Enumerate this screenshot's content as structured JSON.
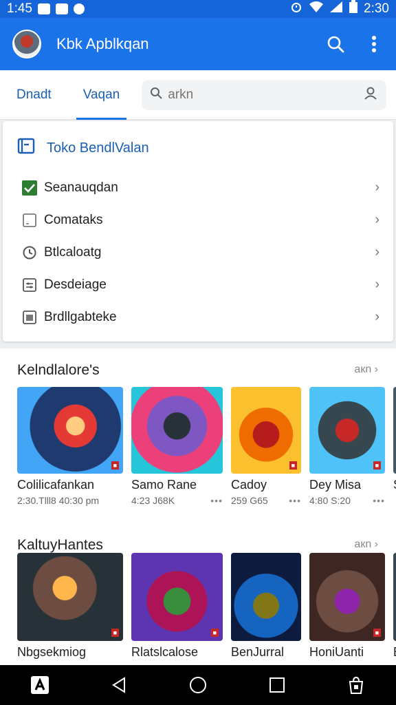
{
  "status_bar": {
    "time_left": "1:45",
    "time_right": "2:30",
    "icons": [
      "image-icon",
      "photo-icon",
      "shield-icon",
      "alarm-icon",
      "wifi-icon",
      "signal-icon",
      "battery-icon"
    ]
  },
  "app_bar": {
    "title": "Kbk Apblkqan",
    "actions": [
      "search-icon",
      "more-vert-icon"
    ]
  },
  "tabs": [
    {
      "label": "Dnadt",
      "selected": false
    },
    {
      "label": "Vaqan",
      "selected": true
    }
  ],
  "search": {
    "value": "",
    "placeholder": "arkn"
  },
  "category_card": {
    "title": "Toko BendlValan",
    "items": [
      {
        "label": "Seanauqdan",
        "icon": "checkbox-checked-icon"
      },
      {
        "label": "Comataks",
        "icon": "checkbox-empty-icon"
      },
      {
        "label": "Btlcaloatg",
        "icon": "history-icon"
      },
      {
        "label": "Desdeiage",
        "icon": "settings-box-icon"
      },
      {
        "label": "Brdllgabteke",
        "icon": "calendar-icon"
      }
    ]
  },
  "section_1": {
    "title": "Kelndlalore's",
    "more": "aкn",
    "games": [
      {
        "name": "Colilicafankan",
        "meta": "2:30.Tlll8  40:30 pm"
      },
      {
        "name": "Samo Rane",
        "meta": "4:23 J68K"
      },
      {
        "name": "Cadoy",
        "meta": "259 G65"
      },
      {
        "name": "Dey Misa",
        "meta": "4:80 S:20"
      },
      {
        "name": "S",
        "meta": ""
      }
    ]
  },
  "section_2": {
    "title": "KaltuyHantes",
    "more": "aкn",
    "games": [
      {
        "name": "Nbgsekmiog",
        "meta": ""
      },
      {
        "name": "Rlatslcalose",
        "meta": ""
      },
      {
        "name": "BenJurral",
        "meta": ""
      },
      {
        "name": "HoniUanti",
        "meta": ""
      },
      {
        "name": "E",
        "meta": ""
      }
    ]
  },
  "nav_bar": {
    "buttons": [
      "app-icon",
      "back-icon",
      "home-icon",
      "recents-icon",
      "lock-bag-icon"
    ]
  },
  "colors": {
    "primary": "#1a73e8",
    "status_bar": "#1565d8",
    "tab_text": "#1a5fb4",
    "check_green": "#2e7d32"
  }
}
